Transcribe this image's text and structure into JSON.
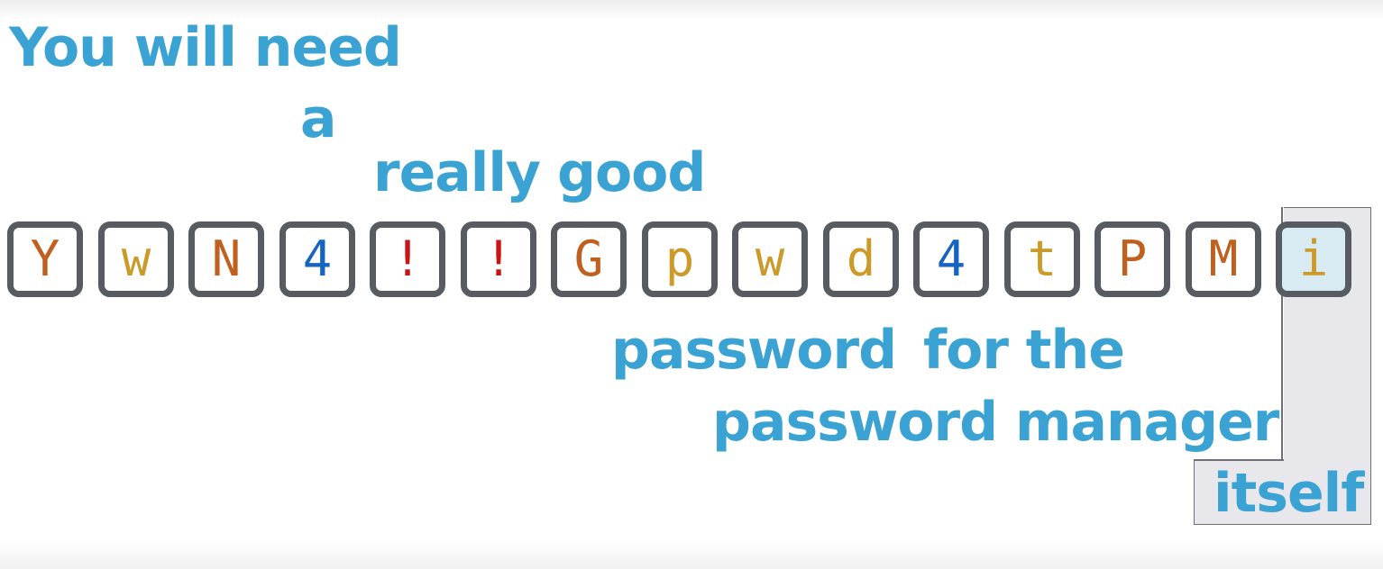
{
  "phrase": {
    "line1": "You will need",
    "line2": "a",
    "line3a": "really",
    "line3b": "good",
    "line4a": "password",
    "line4b": "for the",
    "line5": "password manager",
    "line6": "itself"
  },
  "colors": {
    "text": "#3aa3d4",
    "tile_border": "#575b62",
    "highlight_bg": "#d9ebf2",
    "orange": "#c0601e",
    "gold": "#cc9a28",
    "blue": "#1565c0",
    "red": "#c81414",
    "gray": "#6b6e73"
  },
  "password": [
    {
      "char": "Y",
      "color": "#c0601e"
    },
    {
      "char": "w",
      "color": "#cc9a28"
    },
    {
      "char": "N",
      "color": "#c0601e"
    },
    {
      "char": "4",
      "color": "#1565c0"
    },
    {
      "char": "!",
      "color": "#c81414"
    },
    {
      "char": "!",
      "color": "#c81414"
    },
    {
      "char": "G",
      "color": "#c0601e"
    },
    {
      "char": "p",
      "color": "#cc9a28"
    },
    {
      "char": "w",
      "color": "#cc9a28"
    },
    {
      "char": "d",
      "color": "#cc9a28"
    },
    {
      "char": "4",
      "color": "#1565c0"
    },
    {
      "char": "t",
      "color": "#cc9a28"
    },
    {
      "char": "P",
      "color": "#c0601e"
    },
    {
      "char": "M",
      "color": "#c0601e"
    },
    {
      "char": "i",
      "color": "#cc9a28",
      "highlighted": true
    }
  ]
}
